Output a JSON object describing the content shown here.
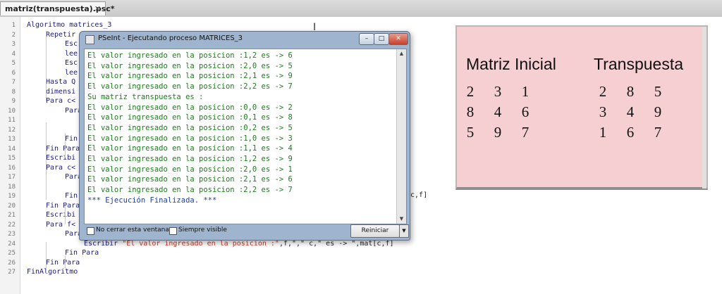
{
  "tab": {
    "name": "matriz(transpuesta).psc*",
    "close": "✕"
  },
  "editor": {
    "lines": [
      {
        "n": "1",
        "text": "Algoritmo matrices_3"
      },
      {
        "n": "2",
        "text": "Repetir"
      },
      {
        "n": "3",
        "text": "Esc"
      },
      {
        "n": "4",
        "text": "lee"
      },
      {
        "n": "5",
        "text": "Esc"
      },
      {
        "n": "6",
        "text": "lee"
      },
      {
        "n": "7",
        "text": "Hasta Q"
      },
      {
        "n": "8",
        "text": "dimensi"
      },
      {
        "n": "9",
        "text": "Para c<"
      },
      {
        "n": "10",
        "text": "Para"
      },
      {
        "n": "11",
        "text": ""
      },
      {
        "n": "12",
        "text": ""
      },
      {
        "n": "13",
        "text": "Fin"
      },
      {
        "n": "14",
        "text": "Fin Para"
      },
      {
        "n": "15",
        "text": "Escribi"
      },
      {
        "n": "16",
        "text": "Para c<"
      },
      {
        "n": "17",
        "text": "Para"
      },
      {
        "n": "18",
        "text": ""
      },
      {
        "n": "19",
        "text": "Fin"
      },
      {
        "n": "20",
        "text": "Fin Para"
      },
      {
        "n": "21",
        "text": "Escribi"
      },
      {
        "n": "22",
        "text": "Para f<"
      },
      {
        "n": "23",
        "text": "Para c<-0 Hasta c-1 Con Paso 1 Hacer"
      },
      {
        "n": "24",
        "text_kw": "Escribir ",
        "text_str": "\"El valor ingresado en la posicion :\"",
        "text_rest": ",f,\",\" c,\" es -> \",mat[c,f]"
      },
      {
        "n": "25",
        "text": "Fin Para"
      },
      {
        "n": "26",
        "text": "Fin Para"
      },
      {
        "n": "27",
        "text": "FinAlgoritmo"
      }
    ],
    "line18_fragment": "[c,f]"
  },
  "console": {
    "title": "PSeInt - Ejecutando proceso MATRICES_3",
    "min_label": "–",
    "max_label": "□",
    "close_label": "✕",
    "output": [
      "El valor ingresado en la posicion :1,2 es -> 6",
      "El valor ingresado en la posicion :2,0 es -> 5",
      "El valor ingresado en la posicion :2,1 es -> 9",
      "El valor ingresado en la posicion :2,2 es -> 7",
      "Su matriz transpuesta es :",
      "El valor ingresado en la posicion :0,0 es -> 2",
      "El valor ingresado en la posicion :0,1 es -> 8",
      "El valor ingresado en la posicion :0,2 es -> 5",
      "El valor ingresado en la posicion :1,0 es -> 3",
      "El valor ingresado en la posicion :1,1 es -> 4",
      "El valor ingresado en la posicion :1,2 es -> 9",
      "El valor ingresado en la posicion :2,0 es -> 1",
      "El valor ingresado en la posicion :2,1 es -> 6",
      "El valor ingresado en la posicion :2,2 es -> 7"
    ],
    "finished": "*** Ejecución Finalizada. ***",
    "no_cerrar_label": "No cerrar esta ventana",
    "siempre_visible_label": "Siempre visible",
    "reiniciar_label": "Reiniciar",
    "dropdown_arrow": "▼"
  },
  "note": {
    "heading_initial": "Matriz Inicial",
    "heading_transposed": "Transpuesta",
    "initial": [
      [
        "2",
        "3",
        "1"
      ],
      [
        "8",
        "4",
        "6"
      ],
      [
        "5",
        "9",
        "7"
      ]
    ],
    "transposed": [
      [
        "2",
        "8",
        "5"
      ],
      [
        "3",
        "4",
        "9"
      ],
      [
        "1",
        "6",
        "7"
      ]
    ]
  }
}
